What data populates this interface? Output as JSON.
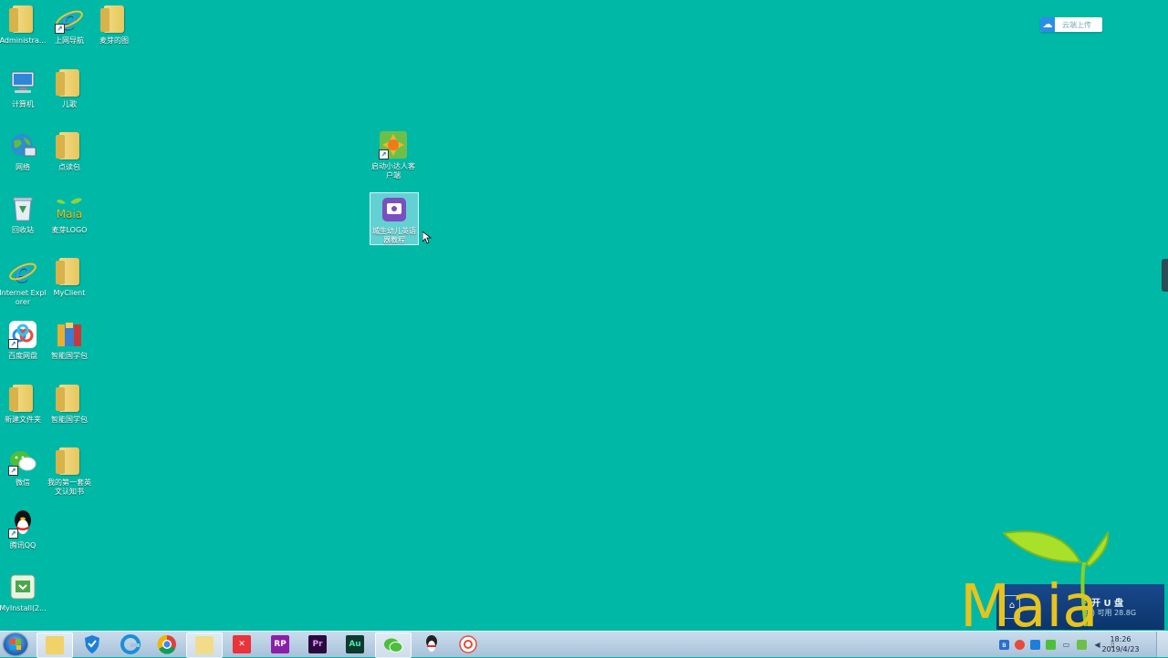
{
  "cloud_upload": {
    "label": "云端上传"
  },
  "desktop": {
    "icons": [
      {
        "label": "Administra..."
      },
      {
        "label": "上网导航"
      },
      {
        "label": "麦芽的图"
      },
      {
        "label": "计算机"
      },
      {
        "label": "儿歌"
      },
      {
        "label": "网络"
      },
      {
        "label": "点读包"
      },
      {
        "label": "回收站"
      },
      {
        "label": "麦芽LOGO"
      },
      {
        "label": "Internet Explorer"
      },
      {
        "label": "MyClient"
      },
      {
        "label": "百度网盘"
      },
      {
        "label": "智能国学包"
      },
      {
        "label": "新建文件夹"
      },
      {
        "label": "智能国学包"
      },
      {
        "label": "微信"
      },
      {
        "label": "我的第一套英文认知书"
      },
      {
        "label": "腾讯QQ"
      },
      {
        "label": "MyInstall(2..."
      },
      {
        "label": "启动小达人客户端"
      },
      {
        "label": "城生幼儿英语器教程"
      }
    ]
  },
  "logo": {
    "text": "Maia"
  },
  "usb_popup": {
    "title": "打开 U 盘",
    "subtitle": "(E:) 可用 28.8G"
  },
  "taskbar": {
    "items": [
      {
        "icon": "explorer-icon"
      },
      {
        "icon": "shield-icon"
      },
      {
        "icon": "edge-icon"
      },
      {
        "icon": "chrome-icon"
      },
      {
        "icon": "folder-icon"
      },
      {
        "icon": "xmind-icon"
      },
      {
        "label": "RP"
      },
      {
        "label": "Pr"
      },
      {
        "label": "Au"
      },
      {
        "icon": "wechat-icon"
      },
      {
        "icon": "qq-icon"
      },
      {
        "icon": "app-icon"
      }
    ],
    "clock": {
      "time": "18:26",
      "date": "2019/4/23"
    }
  },
  "colors": {
    "desktop_bg": "#00b8a6",
    "taskbar": "#b4cde3"
  }
}
